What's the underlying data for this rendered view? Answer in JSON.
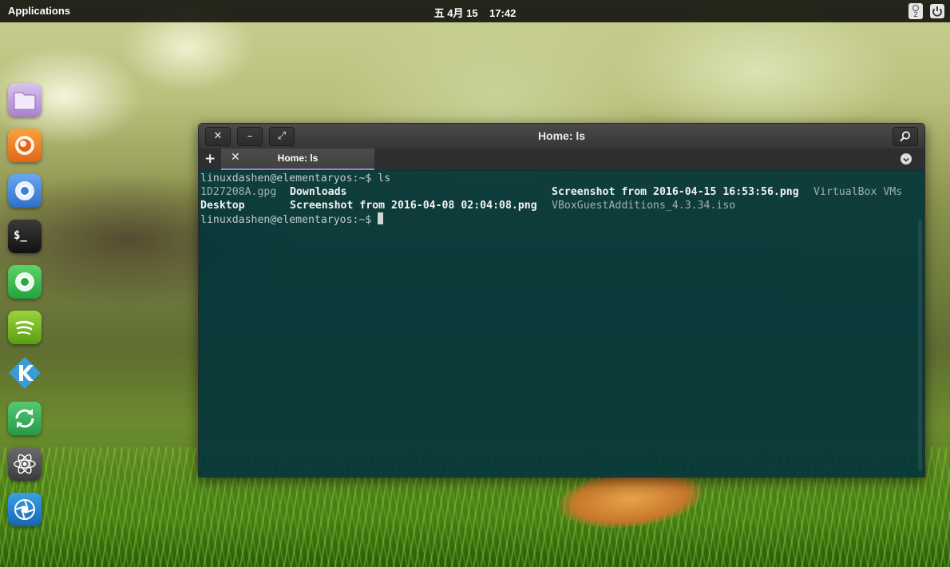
{
  "top_panel": {
    "applications_label": "Applications",
    "clock": "五 4月 15    17:42",
    "indicator_count": "2"
  },
  "dock": {
    "items": [
      {
        "name": "files",
        "icon": "folder-icon"
      },
      {
        "name": "firefox",
        "icon": "firefox-icon"
      },
      {
        "name": "chromium",
        "icon": "chromium-icon"
      },
      {
        "name": "terminal",
        "icon": "terminal-icon"
      },
      {
        "name": "chrome",
        "icon": "chrome-icon"
      },
      {
        "name": "spotify",
        "icon": "spotify-icon"
      },
      {
        "name": "kodi",
        "icon": "kodi-icon"
      },
      {
        "name": "sync",
        "icon": "sync-icon"
      },
      {
        "name": "atom",
        "icon": "atom-icon"
      },
      {
        "name": "shotwell",
        "icon": "shutter-icon"
      }
    ],
    "terminal_glyph": "$_"
  },
  "terminal": {
    "window_title": "Home: ls",
    "tab_label": "Home: ls",
    "lines": {
      "prompt1": "linuxdashen@elementaryos:~$ ls",
      "file_1d": "1D27208A.gpg",
      "file_downloads": "Downloads",
      "file_screenshot1": "Screenshot from 2016-04-15 16:53:56.png",
      "file_vbvms": "VirtualBox VMs",
      "file_desktop": "Desktop",
      "file_screenshot2": "Screenshot from 2016-04-08 02:04:08.png",
      "file_vboxga": "VBoxGuestAdditions_4.3.34.iso",
      "prompt2": "linuxdashen@elementaryos:~$ "
    }
  },
  "colors": {
    "panel": "#000000",
    "terminal_bg": "#04363a",
    "tab_accent": "#a57fd6"
  }
}
